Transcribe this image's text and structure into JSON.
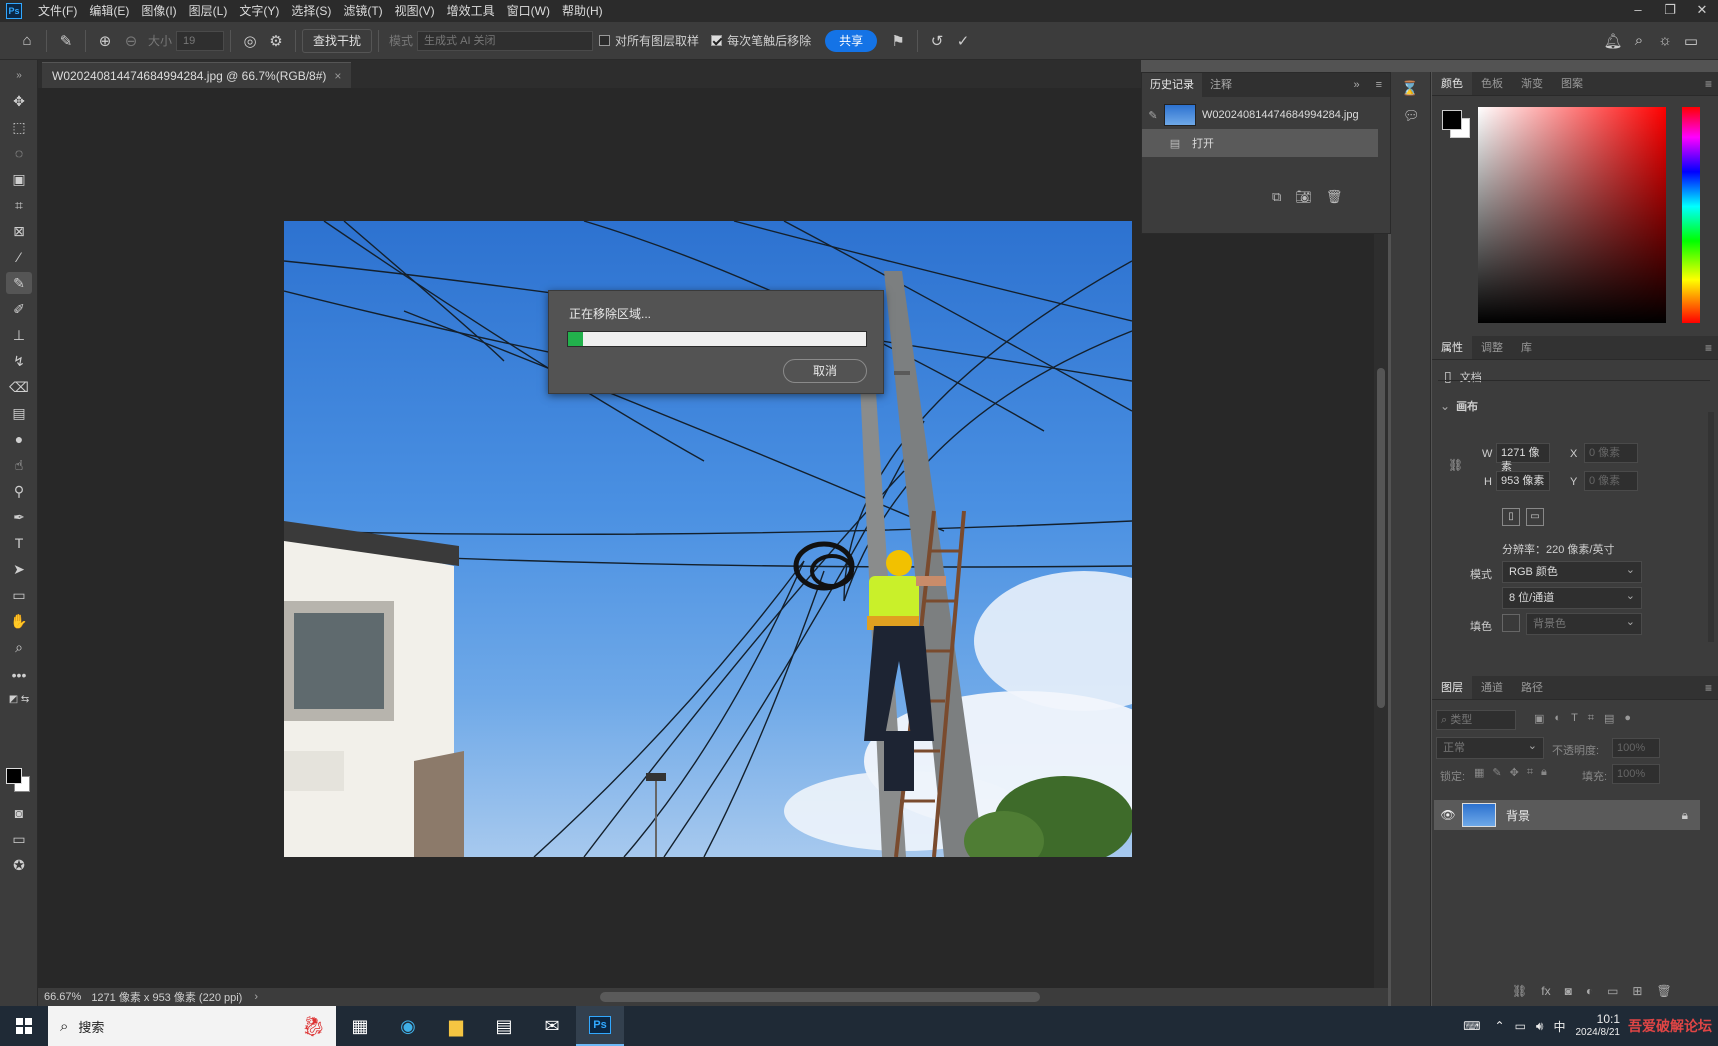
{
  "app": {
    "logo": "Ps"
  },
  "menu": [
    "文件(F)",
    "编辑(E)",
    "图像(I)",
    "图层(L)",
    "文字(Y)",
    "选择(S)",
    "滤镜(T)",
    "视图(V)",
    "增效工具",
    "窗口(W)",
    "帮助(H)"
  ],
  "options": {
    "size_label": "大小",
    "size_value": "19",
    "find_distractions": "查找干扰",
    "mode_label": "模式",
    "mode_value": "生成式 AI 关闭",
    "sample_all_layers": "对所有图层取样",
    "remove_after_stroke": "每次笔触后移除",
    "share": "共享"
  },
  "document": {
    "tab_title": "W020240814474684994284.jpg @ 66.7%(RGB/8#)",
    "close": "×"
  },
  "dialog": {
    "title": "正在移除区域...",
    "progress": 0.05,
    "cancel": "取消"
  },
  "history": {
    "tabs": [
      "历史记录",
      "注释"
    ],
    "snapshot": "W020240814474684994284.jpg",
    "items": [
      {
        "label": "打开"
      }
    ]
  },
  "color_panel": {
    "tabs": [
      "颜色",
      "色板",
      "渐变",
      "图案"
    ]
  },
  "properties": {
    "tabs": [
      "属性",
      "调整",
      "库"
    ],
    "doc_label": "文档",
    "canvas_label": "画布",
    "w_label": "W",
    "w_value": "1271 像素",
    "h_label": "H",
    "h_value": "953 像素",
    "x_label": "X",
    "x_value": "0 像素",
    "y_label": "Y",
    "y_value": "0 像素",
    "resolution": "分辨率：220 像素/英寸",
    "mode_label": "模式",
    "mode_value": "RGB 颜色",
    "depth_value": "8 位/通道",
    "fill_label": "填色",
    "fill_value": "背景色"
  },
  "layers": {
    "tabs": [
      "图层",
      "通道",
      "路径"
    ],
    "filter_placeholder": "类型",
    "blend_mode": "正常",
    "opacity_label": "不透明度:",
    "opacity_value": "100%",
    "lock_label": "锁定:",
    "fill_label": "填充:",
    "fill_value": "100%",
    "layer_name": "背景"
  },
  "status": {
    "zoom": "66.67%",
    "info": "1271 像素 x 953 像素 (220 ppi)"
  },
  "taskbar": {
    "search_placeholder": "搜索",
    "ime": "中",
    "time": "10:1",
    "date": "2024/8/21",
    "watermark": "吾爱破解论坛"
  },
  "colors": {
    "accent": "#1473e6",
    "progress_fill": "#22b14c",
    "panel_bg": "#3c3c3c",
    "canvas_bg": "#282828"
  }
}
